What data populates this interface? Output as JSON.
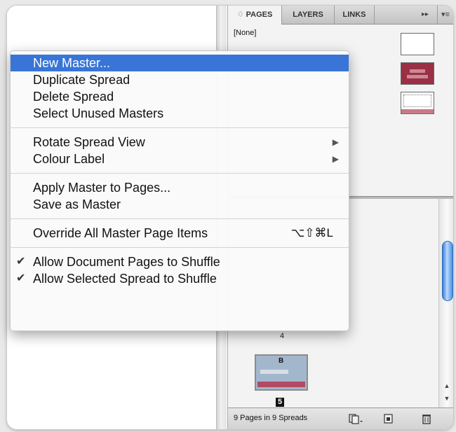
{
  "panel": {
    "tabs": [
      {
        "label": "♢ PAGES"
      },
      {
        "label": "LAYERS"
      },
      {
        "label": "LINKS"
      }
    ],
    "tab_arrows": "▸▸",
    "tab_menu": "▾≡",
    "masters": [
      {
        "label": "[None]"
      }
    ],
    "page4_number": "4",
    "spread_master_letter": "B",
    "page5_number": "5",
    "footer_status": "9 Pages in 9 Spreads"
  },
  "menu": {
    "items": [
      {
        "label": "New Master..."
      },
      {
        "label": "Duplicate Spread"
      },
      {
        "label": "Delete Spread"
      },
      {
        "label": "Select Unused Masters"
      },
      {
        "label": "Rotate Spread View"
      },
      {
        "label": "Colour Label"
      },
      {
        "label": "Apply Master to Pages..."
      },
      {
        "label": "Save as Master"
      },
      {
        "label": "Override All Master Page Items",
        "shortcut": "⌥⇧⌘L"
      },
      {
        "label": "Allow Document Pages to Shuffle"
      },
      {
        "label": "Allow Selected Spread to Shuffle"
      }
    ],
    "submenu_arrow": "▶",
    "check_mark": "✔"
  },
  "colors": {
    "highlight": "#3875d7",
    "master_b_color": "#9b2f43"
  }
}
